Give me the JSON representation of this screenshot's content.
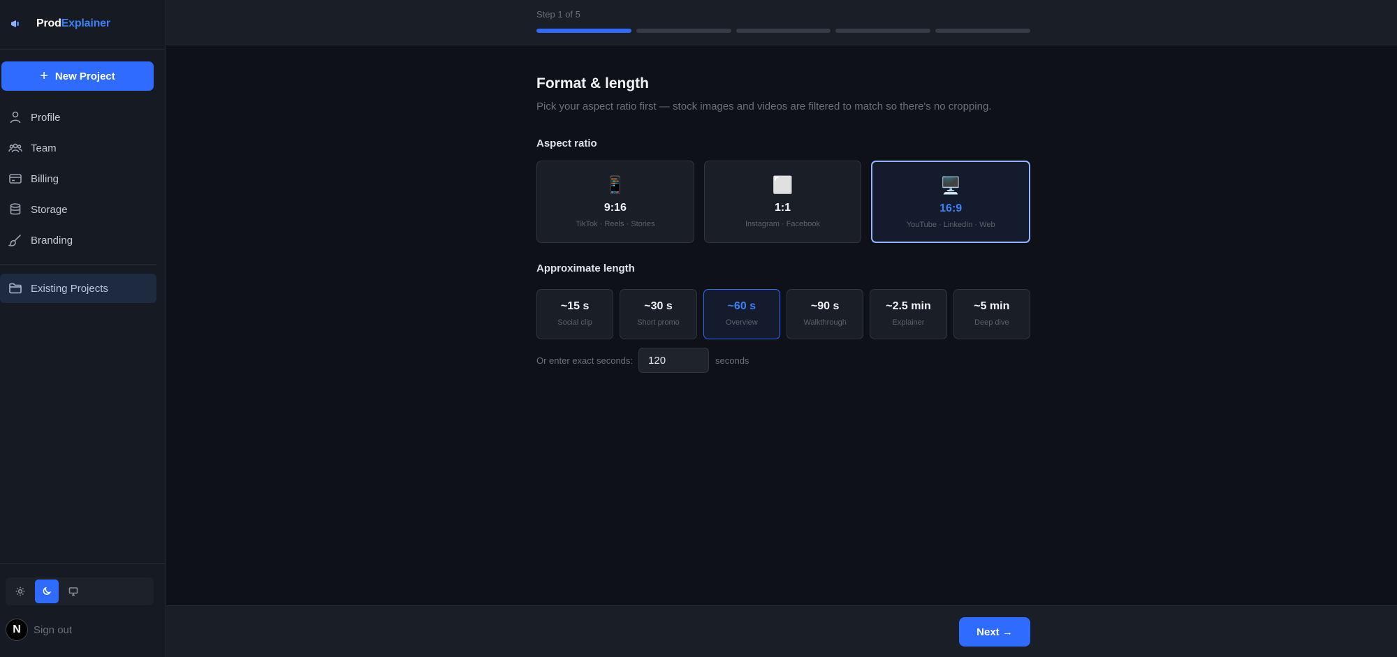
{
  "brand": {
    "name_part1": "Prod",
    "name_part2": "Explainer"
  },
  "sidebar": {
    "new_project_label": "New Project",
    "items": [
      {
        "label": "Profile",
        "icon": "user-icon"
      },
      {
        "label": "Team",
        "icon": "team-icon"
      },
      {
        "label": "Billing",
        "icon": "credit-card-icon"
      },
      {
        "label": "Storage",
        "icon": "database-icon"
      },
      {
        "label": "Branding",
        "icon": "paintbrush-icon"
      }
    ],
    "existing_projects_label": "Existing Projects",
    "theme": {
      "options": [
        "light",
        "dark",
        "system"
      ],
      "selected": "dark"
    },
    "avatar_initial": "N",
    "signout_label": "Sign out"
  },
  "progress": {
    "step_label": "Step 1 of 5",
    "current": 1,
    "total": 5
  },
  "main": {
    "title": "Format & length",
    "subtitle": "Pick your aspect ratio first — stock images and videos are filtered to match so there's no cropping.",
    "aspect_section_label": "Aspect ratio",
    "aspect_options": [
      {
        "icon": "📱",
        "ratio": "9:16",
        "platforms": "TikTok · Reels · Stories",
        "selected": false
      },
      {
        "icon": "⬜",
        "ratio": "1:1",
        "platforms": "Instagram · Facebook",
        "selected": false
      },
      {
        "icon": "🖥️",
        "ratio": "16:9",
        "platforms": "YouTube · LinkedIn · Web",
        "selected": true
      }
    ],
    "length_section_label": "Approximate length",
    "length_options": [
      {
        "value": "~15 s",
        "desc": "Social clip",
        "selected": false
      },
      {
        "value": "~30 s",
        "desc": "Short promo",
        "selected": false
      },
      {
        "value": "~60 s",
        "desc": "Overview",
        "selected": true
      },
      {
        "value": "~90 s",
        "desc": "Walkthrough",
        "selected": false
      },
      {
        "value": "~2.5 min",
        "desc": "Explainer",
        "selected": false
      },
      {
        "value": "~5 min",
        "desc": "Deep dive",
        "selected": false
      }
    ],
    "exact_label": "Or enter exact seconds:",
    "exact_value": "120",
    "exact_unit": "seconds"
  },
  "footer": {
    "next_label": "Next →"
  },
  "colors": {
    "accent": "#2f6bff",
    "selected_border": "#94b4ff",
    "background": "#0e1118",
    "sidebar": "#161a22"
  }
}
